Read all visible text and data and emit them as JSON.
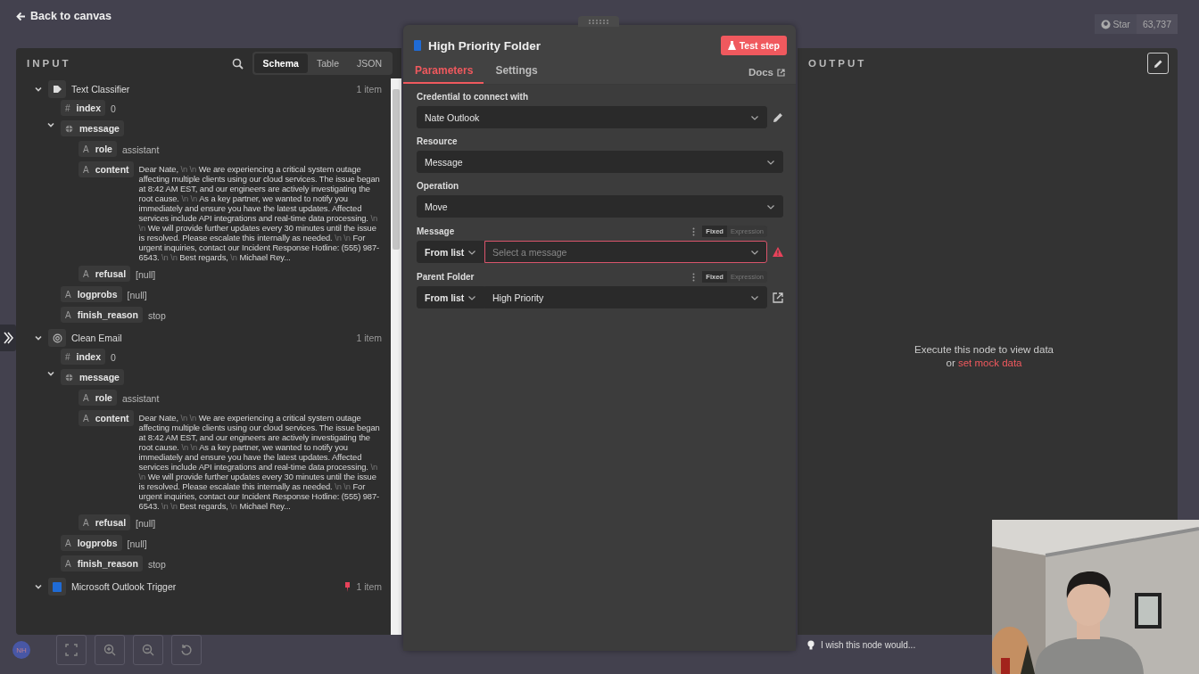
{
  "top_bar": {
    "back_link": "Back to canvas",
    "github": {
      "label": "Star",
      "count": "63,737"
    }
  },
  "input": {
    "title": "INPUT",
    "view_tabs": [
      {
        "label": "Schema",
        "selected": true
      },
      {
        "label": "Table",
        "selected": false
      },
      {
        "label": "JSON",
        "selected": false
      }
    ],
    "nodes": [
      {
        "name": "Text Classifier",
        "count": "1 item",
        "expanded": true,
        "fields": [
          {
            "kind": "value",
            "symbol": "#",
            "key": "index",
            "value": "0"
          },
          {
            "kind": "object",
            "key": "message",
            "expanded": true,
            "children": [
              {
                "kind": "value",
                "symbol": "A",
                "key": "role",
                "value": "assistant"
              },
              {
                "kind": "text",
                "symbol": "A",
                "key": "content",
                "segments": [
                  {
                    "kind": "text",
                    "text": "Dear Nate,"
                  },
                  {
                    "kind": "escape",
                    "text": "\\n \\n"
                  },
                  {
                    "kind": "text",
                    "text": "We are experiencing a critical system outage affecting multiple clients using our cloud services. The issue began at 8:42 AM EST, and our engineers are actively investigating the root cause."
                  },
                  {
                    "kind": "escape",
                    "text": "\\n \\n"
                  },
                  {
                    "kind": "text",
                    "text": "As a key partner, we wanted to notify you immediately and ensure you have the latest updates. Affected services include API integrations and real-time data processing."
                  },
                  {
                    "kind": "escape",
                    "text": "\\n \\n"
                  },
                  {
                    "kind": "text",
                    "text": "We will provide further updates every 30 minutes until the issue is resolved. Please escalate this internally as needed."
                  },
                  {
                    "kind": "escape",
                    "text": "\\n \\n"
                  },
                  {
                    "kind": "text",
                    "text": "For urgent inquiries, contact our Incident Response Hotline: (555) 987-6543."
                  },
                  {
                    "kind": "escape",
                    "text": "\\n \\n"
                  },
                  {
                    "kind": "text",
                    "text": "Best regards, "
                  },
                  {
                    "kind": "escape",
                    "text": "\\n"
                  },
                  {
                    "kind": "text",
                    "text": "Michael Rey..."
                  }
                ]
              },
              {
                "kind": "value",
                "symbol": "A",
                "key": "refusal",
                "value": "[null]"
              }
            ]
          },
          {
            "kind": "value",
            "symbol": "A",
            "key": "logprobs",
            "value": "[null]"
          },
          {
            "kind": "value",
            "symbol": "A",
            "key": "finish_reason",
            "value": "stop"
          }
        ]
      },
      {
        "name": "Clean Email",
        "count": "1 item",
        "expanded": true,
        "fields": [
          {
            "kind": "value",
            "symbol": "#",
            "key": "index",
            "value": "0"
          },
          {
            "kind": "object",
            "key": "message",
            "expanded": true,
            "children": [
              {
                "kind": "value",
                "symbol": "A",
                "key": "role",
                "value": "assistant"
              },
              {
                "kind": "text",
                "symbol": "A",
                "key": "content",
                "segments": [
                  {
                    "kind": "text",
                    "text": "Dear Nate,"
                  },
                  {
                    "kind": "escape",
                    "text": "\\n \\n"
                  },
                  {
                    "kind": "text",
                    "text": "We are experiencing a critical system outage affecting multiple clients using our cloud services. The issue began at 8:42 AM EST, and our engineers are actively investigating the root cause."
                  },
                  {
                    "kind": "escape",
                    "text": "\\n \\n"
                  },
                  {
                    "kind": "text",
                    "text": "As a key partner, we wanted to notify you immediately and ensure you have the latest updates. Affected services include API integrations and real-time data processing."
                  },
                  {
                    "kind": "escape",
                    "text": "\\n \\n"
                  },
                  {
                    "kind": "text",
                    "text": "We will provide further updates every 30 minutes until the issue is resolved. Please escalate this internally as needed."
                  },
                  {
                    "kind": "escape",
                    "text": "\\n \\n"
                  },
                  {
                    "kind": "text",
                    "text": "For urgent inquiries, contact our Incident Response Hotline: (555) 987-6543."
                  },
                  {
                    "kind": "escape",
                    "text": "\\n \\n"
                  },
                  {
                    "kind": "text",
                    "text": "Best regards, "
                  },
                  {
                    "kind": "escape",
                    "text": "\\n"
                  },
                  {
                    "kind": "text",
                    "text": "Michael Rey..."
                  }
                ]
              },
              {
                "kind": "value",
                "symbol": "A",
                "key": "refusal",
                "value": "[null]"
              }
            ]
          },
          {
            "kind": "value",
            "symbol": "A",
            "key": "logprobs",
            "value": "[null]"
          },
          {
            "kind": "value",
            "symbol": "A",
            "key": "finish_reason",
            "value": "stop"
          }
        ]
      },
      {
        "name": "Microsoft Outlook Trigger",
        "count": "1 item",
        "expanded": true,
        "pinned": true
      }
    ]
  },
  "node_panel": {
    "title": "High Priority Folder",
    "test_button": "Test step",
    "tabs": [
      {
        "label": "Parameters",
        "selected": true
      },
      {
        "label": "Settings",
        "selected": false
      }
    ],
    "docs": "Docs",
    "params": [
      {
        "kind": "select",
        "label": "Credential to connect with",
        "value": "Nate Outlook"
      },
      {
        "kind": "select",
        "label": "Resource",
        "value": "Message"
      },
      {
        "kind": "select",
        "label": "Operation",
        "value": "Move"
      },
      {
        "kind": "locator",
        "label": "Message",
        "mode": "From list",
        "placeholder": "Select a message",
        "error": true,
        "toggle": [
          {
            "label": "Fixed",
            "selected": true
          },
          {
            "label": "Expression",
            "selected": false
          }
        ]
      },
      {
        "kind": "locator",
        "label": "Parent Folder",
        "mode": "From list",
        "value": "High Priority",
        "error": false,
        "toggle": [
          {
            "label": "Fixed",
            "selected": true
          },
          {
            "label": "Expression",
            "selected": false
          }
        ]
      }
    ]
  },
  "output": {
    "title": "OUTPUT",
    "empty_text": "Execute this node to view data",
    "or": "or",
    "mock_link": "set mock data"
  },
  "feedback": "I wish this node would...",
  "bottom_bar": {
    "avatar": "NH"
  }
}
